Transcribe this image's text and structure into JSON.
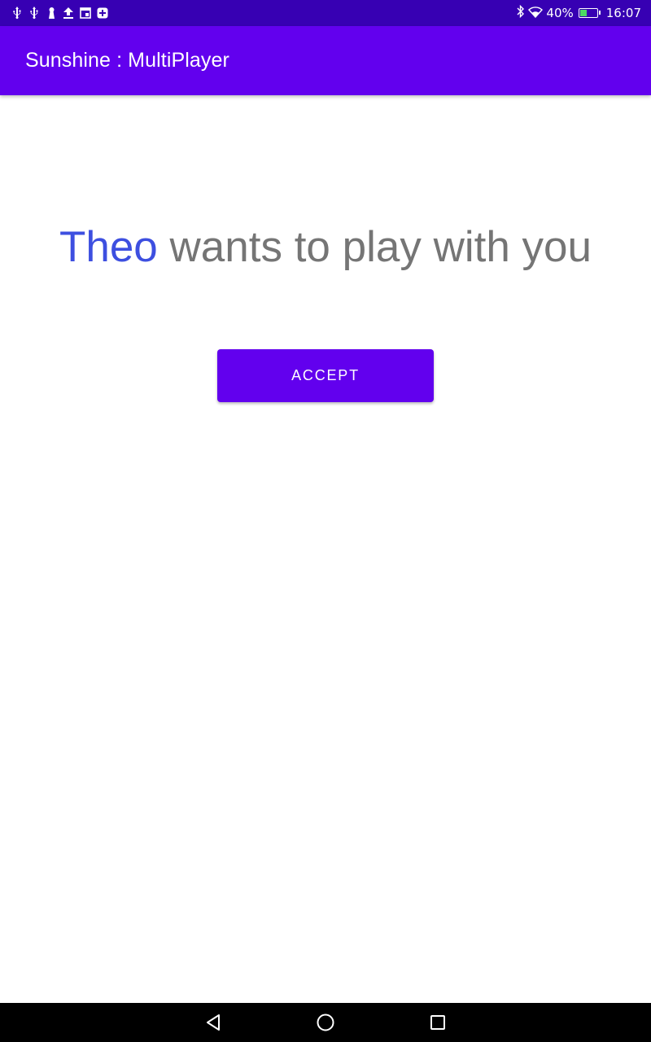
{
  "status_bar": {
    "battery_percent": "40%",
    "battery_level": 0.4,
    "time": "16:07",
    "left_icons": [
      "usb-icon",
      "usb-icon",
      "keyhole-icon",
      "upload-icon",
      "window-icon",
      "add-box-icon"
    ],
    "right_icons": [
      "bluetooth-icon",
      "wifi-icon",
      "battery-icon"
    ]
  },
  "app_bar": {
    "title": "Sunshine : MultiPlayer"
  },
  "invite": {
    "player_name": "Theo",
    "message": " wants to play with you"
  },
  "actions": {
    "accept_label": "ACCEPT"
  },
  "nav_bar": {
    "buttons": [
      "back-icon",
      "home-icon",
      "recents-icon"
    ]
  },
  "colors": {
    "status_bar": "#3700b3",
    "primary": "#6200ee",
    "player_name": "#3d4fe0",
    "message_text": "#757575"
  }
}
